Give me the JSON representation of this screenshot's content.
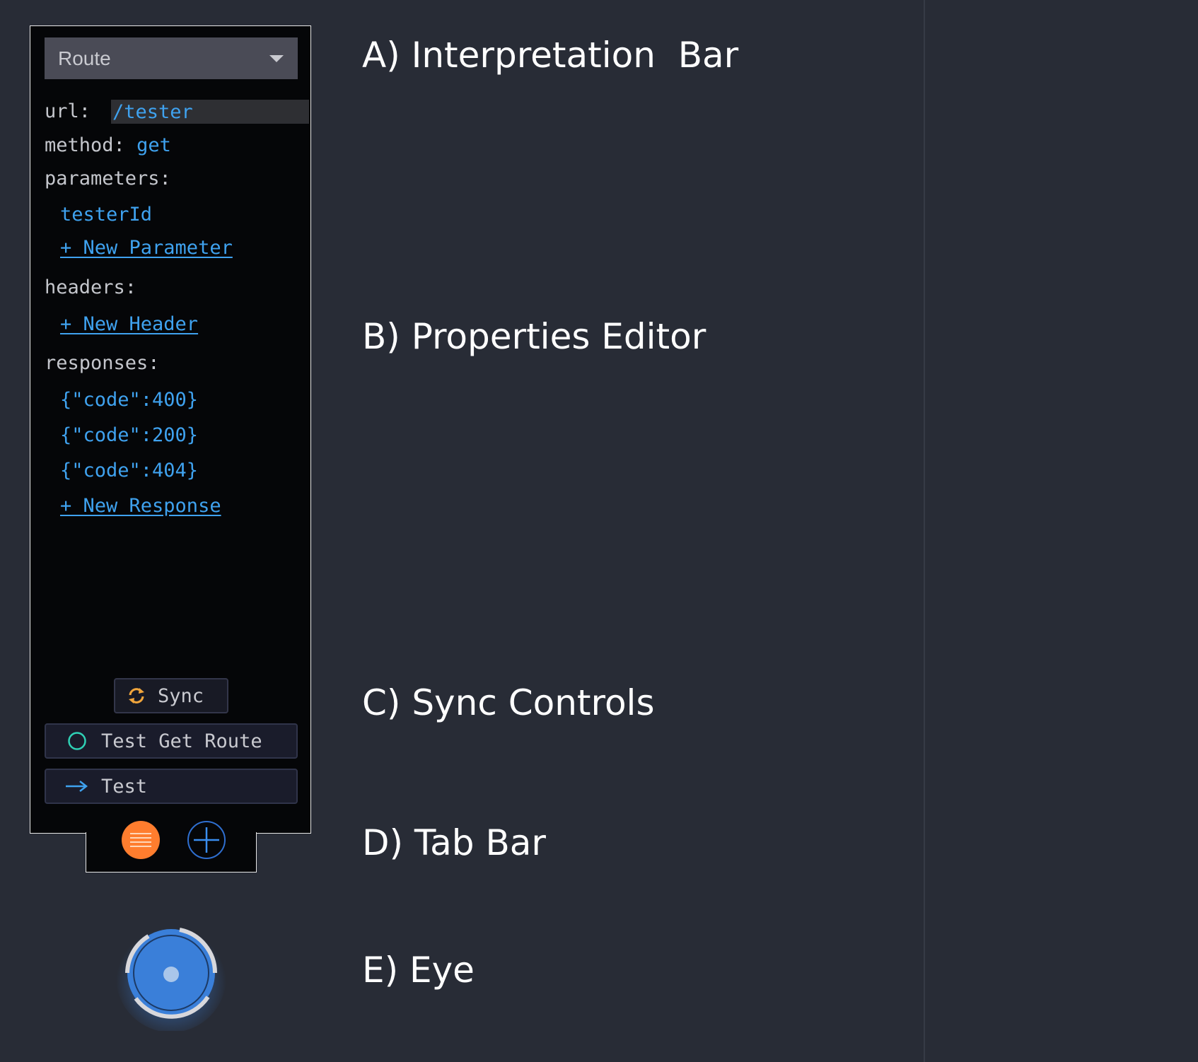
{
  "interpretation_bar": {
    "selected": "Route"
  },
  "properties": {
    "url_label": "url:",
    "url_value": "/tester",
    "method_label": "method:",
    "method_value": "get",
    "parameters_label": "parameters:",
    "parameters": [
      "testerId"
    ],
    "new_parameter": "+ New Parameter",
    "headers_label": "headers:",
    "new_header": "+ New Header",
    "responses_label": "responses:",
    "responses": [
      "{\"code\":400}",
      "{\"code\":200}",
      "{\"code\":404}"
    ],
    "new_response": "+ New Response"
  },
  "sync_controls": {
    "sync_label": "Sync",
    "test_route_label": "Test Get Route",
    "test_label": "Test"
  },
  "tab_bar": {
    "tabs": [
      "menu-icon",
      "plus-icon"
    ]
  },
  "annotations": {
    "a": "A) Interpretation  Bar",
    "b": "B) Properties Editor",
    "c": "C) Sync Controls",
    "d": "D) Tab Bar",
    "e": "E) Eye"
  },
  "colors": {
    "background": "#282c36",
    "panel": "#050608",
    "accent_blue": "#3fa2ef",
    "orange": "#ff7d2e",
    "teal": "#2fd1b5",
    "eye_blue": "#3a7fd9"
  }
}
